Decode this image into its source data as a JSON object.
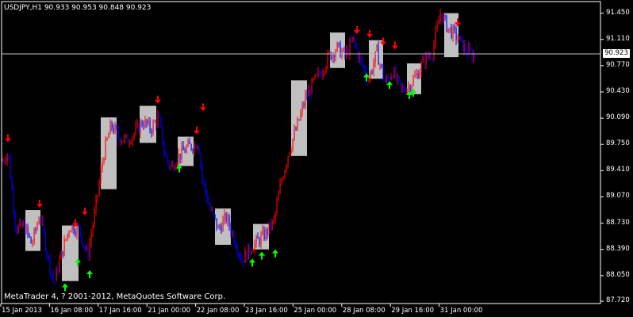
{
  "header": {
    "symbol_line": "USDJPY,H1  90.933 90.953 90.848 90.923"
  },
  "footer": {
    "copyright": "MetaTrader 4, ? 2001-2012, MetaQuotes Software Corp."
  },
  "current_price": {
    "label": "90.923",
    "value": 90.923
  },
  "colors": {
    "background": "#000000",
    "up_candle": "#ff0000",
    "down_candle": "#0000ff",
    "box": "#c0c0c0",
    "up_arrow": "#00ff00",
    "down_arrow": "#ff0000",
    "grid_line": "#ffffff",
    "text": "#ffffff"
  },
  "chart_data": {
    "type": "candlestick",
    "symbol": "USDJPY",
    "timeframe": "H1",
    "ylim": [
      87.72,
      91.6
    ],
    "y_ticks": [
      "91.450",
      "91.110",
      "90.770",
      "90.430",
      "90.090",
      "89.750",
      "89.410",
      "89.070",
      "88.730",
      "88.390",
      "88.050",
      "87.720"
    ],
    "x_ticks": [
      "15 Jan 2013",
      "16 Jan 08:00",
      "17 Jan 16:00",
      "21 Jan 00:00",
      "22 Jan 08:00",
      "23 Jan 16:00",
      "25 Jan 00:00",
      "28 Jan 08:00",
      "29 Jan 16:00",
      "31 Jan 00:00"
    ],
    "price_path": [
      [
        0,
        89.5
      ],
      [
        10,
        89.65
      ],
      [
        20,
        88.65
      ],
      [
        30,
        88.7
      ],
      [
        40,
        88.45
      ],
      [
        50,
        88.85
      ],
      [
        60,
        88.3
      ],
      [
        68,
        87.95
      ],
      [
        78,
        88.35
      ],
      [
        88,
        88.7
      ],
      [
        100,
        88.65
      ],
      [
        110,
        88.3
      ],
      [
        120,
        88.9
      ],
      [
        130,
        89.6
      ],
      [
        140,
        90.0
      ],
      [
        150,
        89.85
      ],
      [
        160,
        89.8
      ],
      [
        170,
        89.9
      ],
      [
        180,
        90.05
      ],
      [
        190,
        89.95
      ],
      [
        200,
        90.1
      ],
      [
        208,
        89.6
      ],
      [
        215,
        89.45
      ],
      [
        225,
        89.6
      ],
      [
        235,
        89.7
      ],
      [
        245,
        89.75
      ],
      [
        250,
        89.8
      ],
      [
        255,
        89.3
      ],
      [
        265,
        88.9
      ],
      [
        275,
        88.65
      ],
      [
        285,
        88.8
      ],
      [
        295,
        88.55
      ],
      [
        305,
        88.25
      ],
      [
        315,
        88.4
      ],
      [
        325,
        88.5
      ],
      [
        335,
        88.6
      ],
      [
        345,
        88.75
      ],
      [
        355,
        89.3
      ],
      [
        365,
        89.7
      ],
      [
        375,
        90.0
      ],
      [
        385,
        90.35
      ],
      [
        395,
        90.55
      ],
      [
        405,
        90.7
      ],
      [
        415,
        90.9
      ],
      [
        425,
        91.0
      ],
      [
        435,
        90.9
      ],
      [
        445,
        91.1
      ],
      [
        455,
        90.8
      ],
      [
        465,
        90.6
      ],
      [
        475,
        90.95
      ],
      [
        485,
        90.55
      ],
      [
        495,
        90.7
      ],
      [
        505,
        90.45
      ],
      [
        515,
        90.5
      ],
      [
        525,
        90.65
      ],
      [
        535,
        90.85
      ],
      [
        545,
        90.95
      ],
      [
        555,
        91.45
      ],
      [
        565,
        91.25
      ],
      [
        575,
        91.15
      ],
      [
        585,
        91.0
      ],
      [
        595,
        90.9
      ],
      [
        600,
        90.92
      ]
    ],
    "boxes": [
      {
        "x0": 32,
        "x1": 51,
        "hi": 88.9,
        "lo": 88.37
      },
      {
        "x0": 78,
        "x1": 99,
        "hi": 88.7,
        "lo": 87.98
      },
      {
        "x0": 127,
        "x1": 147,
        "hi": 90.1,
        "lo": 89.17
      },
      {
        "x0": 176,
        "x1": 197,
        "hi": 90.25,
        "lo": 89.77
      },
      {
        "x0": 224,
        "x1": 244,
        "hi": 89.85,
        "lo": 89.47
      },
      {
        "x0": 271,
        "x1": 291,
        "hi": 88.92,
        "lo": 88.45
      },
      {
        "x0": 319,
        "x1": 339,
        "hi": 88.72,
        "lo": 88.39
      },
      {
        "x0": 367,
        "x1": 387,
        "hi": 90.58,
        "lo": 89.6
      },
      {
        "x0": 416,
        "x1": 435,
        "hi": 91.2,
        "lo": 90.74
      },
      {
        "x0": 465,
        "x1": 483,
        "hi": 91.1,
        "lo": 90.6
      },
      {
        "x0": 513,
        "x1": 531,
        "hi": 90.8,
        "lo": 90.4
      },
      {
        "x0": 560,
        "x1": 578,
        "hi": 91.45,
        "lo": 90.88
      }
    ],
    "up_arrows": [
      {
        "x": 82,
        "price": 87.93
      },
      {
        "x": 98,
        "price": 88.25
      },
      {
        "x": 113,
        "price": 88.1
      },
      {
        "x": 226,
        "price": 89.47
      },
      {
        "x": 318,
        "price": 88.25
      },
      {
        "x": 330,
        "price": 88.34
      },
      {
        "x": 347,
        "price": 88.37
      },
      {
        "x": 462,
        "price": 90.65
      },
      {
        "x": 491,
        "price": 90.55
      },
      {
        "x": 516,
        "price": 90.42
      },
      {
        "x": 521,
        "price": 90.45
      }
    ],
    "down_arrows": [
      {
        "x": 10,
        "price": 89.8
      },
      {
        "x": 50,
        "price": 88.95
      },
      {
        "x": 95,
        "price": 88.7
      },
      {
        "x": 107,
        "price": 88.85
      },
      {
        "x": 199,
        "price": 90.3
      },
      {
        "x": 248,
        "price": 89.9
      },
      {
        "x": 256,
        "price": 90.2
      },
      {
        "x": 450,
        "price": 91.2
      },
      {
        "x": 466,
        "price": 91.15
      },
      {
        "x": 483,
        "price": 91.05
      },
      {
        "x": 498,
        "price": 91.0
      },
      {
        "x": 577,
        "price": 91.3
      }
    ]
  }
}
